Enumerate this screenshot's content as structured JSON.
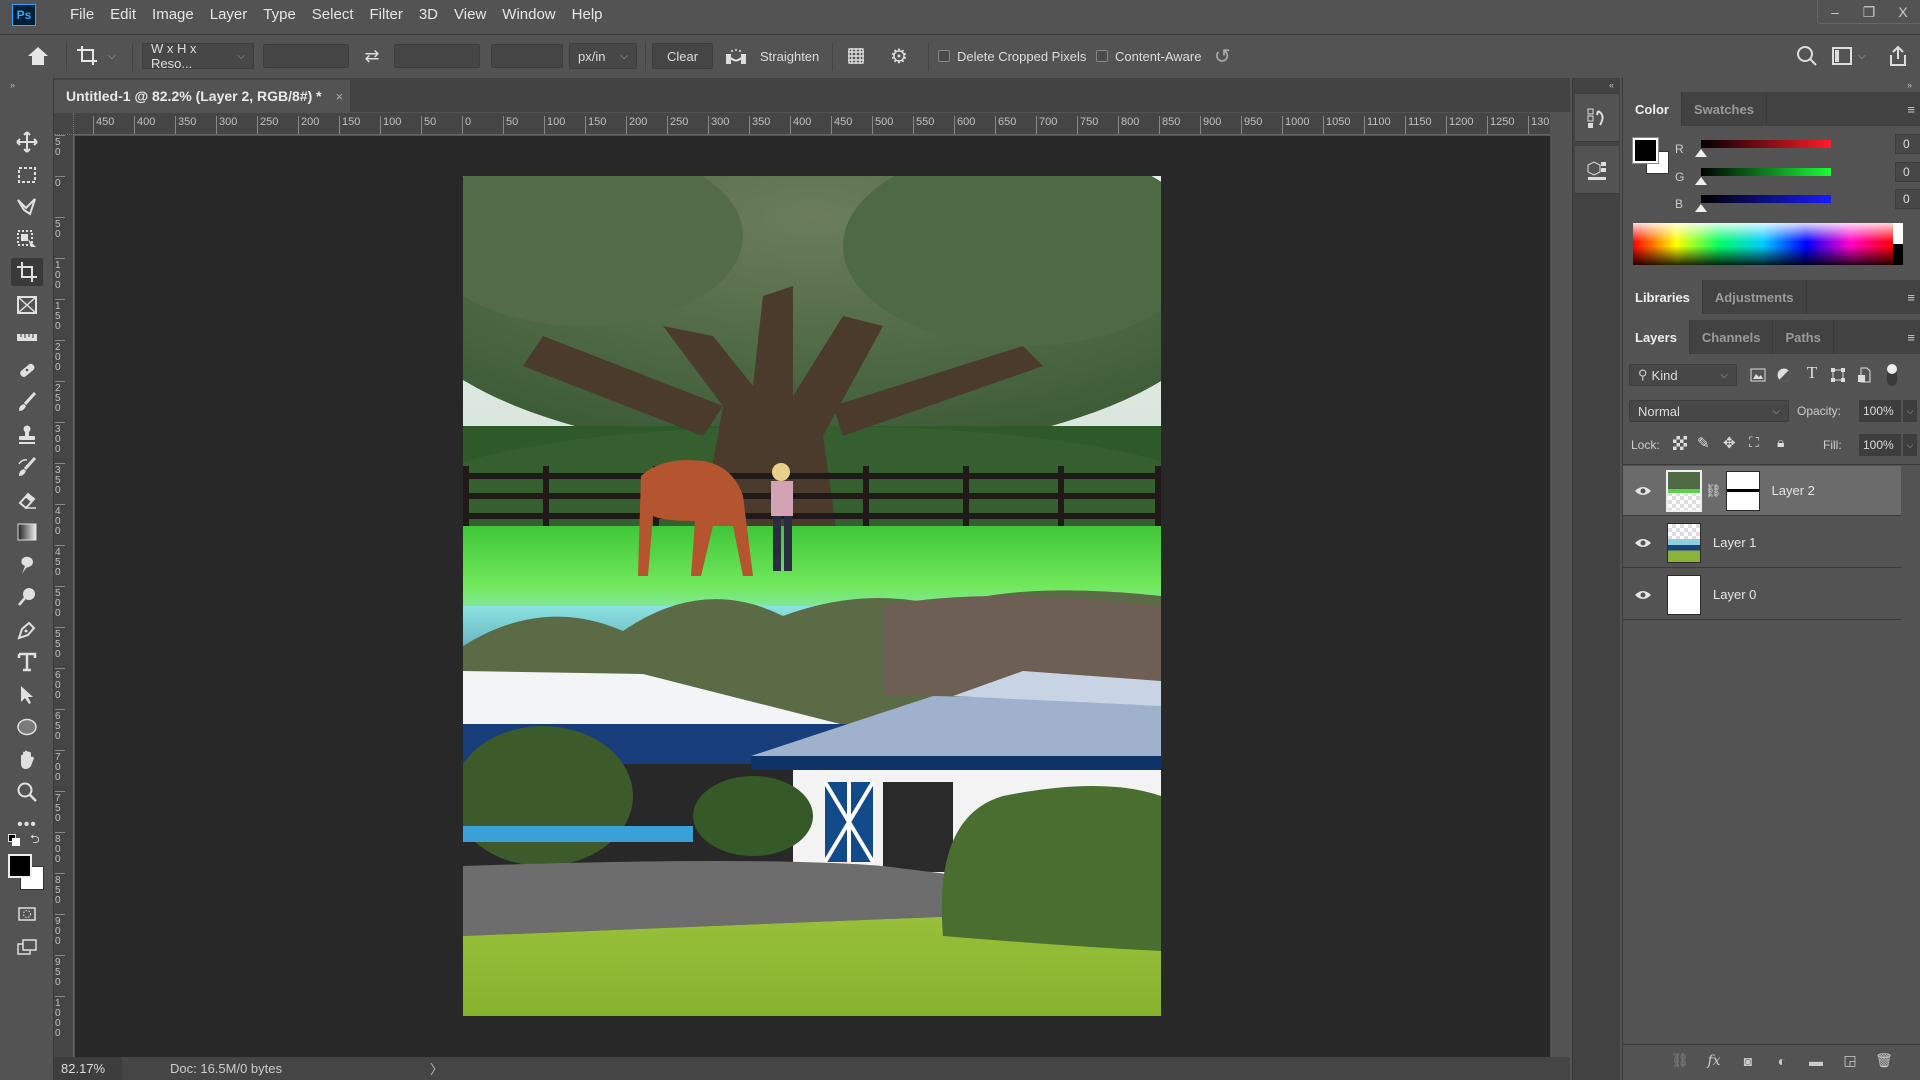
{
  "app": {
    "logo": "Ps",
    "name": "Adobe Photoshop"
  },
  "menu": [
    "File",
    "Edit",
    "Image",
    "Layer",
    "Type",
    "Select",
    "Filter",
    "3D",
    "View",
    "Window",
    "Help"
  ],
  "window_controls": {
    "minimize": "–",
    "restore": "❐",
    "close": "X"
  },
  "options_bar": {
    "ratio_dropdown": "W x H x Reso...",
    "width_value": "",
    "height_value": "",
    "resolution_value": "",
    "units_dropdown": "px/in",
    "clear_label": "Clear",
    "straighten_label": "Straighten",
    "delete_cropped_label": "Delete Cropped Pixels",
    "delete_cropped_checked": false,
    "content_aware_label": "Content-Aware",
    "content_aware_checked": false
  },
  "document": {
    "tab_title": "Untitled-1 @ 82.2% (Layer 2, RGB/8#) *",
    "close": "×",
    "zoom_level": "82.17%",
    "doc_info": "Doc: 16.5M/0 bytes",
    "status_arrow": "〉"
  },
  "ruler_top_labels": [
    "450",
    "400",
    "350",
    "300",
    "250",
    "200",
    "150",
    "100",
    "50",
    "0",
    "50",
    "100",
    "150",
    "200",
    "250",
    "300",
    "350",
    "400",
    "450",
    "500",
    "550",
    "600",
    "650",
    "700",
    "750",
    "800",
    "850",
    "900",
    "950",
    "1000",
    "1050",
    "1100",
    "1150",
    "1200",
    "1250",
    "130"
  ],
  "ruler_left_labels": [
    "50",
    "0",
    "50",
    "100",
    "150",
    "200",
    "250",
    "300",
    "350",
    "400",
    "450",
    "500",
    "550",
    "600",
    "650",
    "700",
    "750",
    "800",
    "850",
    "900",
    "950",
    "1000"
  ],
  "tools": [
    "move",
    "marquee",
    "lasso",
    "object-selection",
    "crop",
    "frame",
    "ruler",
    "healing",
    "brush",
    "stamp",
    "history-brush",
    "eraser",
    "gradient",
    "smudge",
    "dodge",
    "pen",
    "type",
    "path-selection",
    "ellipse",
    "hand",
    "zoom",
    "more"
  ],
  "active_tool": "crop",
  "foreground_color": "#000000",
  "background_color": "#ffffff",
  "color_panel": {
    "tabs": [
      {
        "label": "Color",
        "active": true
      },
      {
        "label": "Swatches",
        "active": false
      }
    ],
    "sliders": [
      {
        "channel": "R",
        "value": "0",
        "end_color": "#ff1a2a"
      },
      {
        "channel": "G",
        "value": "0",
        "end_color": "#1aff3a"
      },
      {
        "channel": "B",
        "value": "0",
        "end_color": "#1a1aff"
      }
    ]
  },
  "libraries_panel": {
    "tabs": [
      {
        "label": "Libraries",
        "active": true
      },
      {
        "label": "Adjustments",
        "active": false
      }
    ]
  },
  "layers_panel": {
    "tabs": [
      {
        "label": "Layers",
        "active": true
      },
      {
        "label": "Channels",
        "active": false
      },
      {
        "label": "Paths",
        "active": false
      }
    ],
    "filter_label": "Kind",
    "blend_mode": "Normal",
    "opacity_label": "Opacity:",
    "opacity_value": "100%",
    "lock_label": "Lock:",
    "fill_label": "Fill:",
    "fill_value": "100%",
    "layers": [
      {
        "name": "Layer 2",
        "visible": true,
        "selected": true,
        "has_mask": true
      },
      {
        "name": "Layer 1",
        "visible": true,
        "selected": false,
        "has_mask": false
      },
      {
        "name": "Layer 0",
        "visible": true,
        "selected": false,
        "has_mask": false
      }
    ]
  }
}
